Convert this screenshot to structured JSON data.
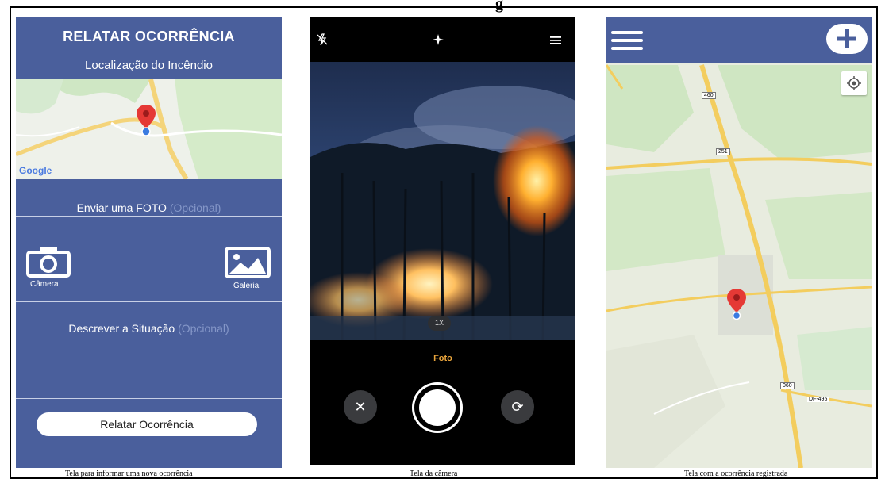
{
  "figure_title": "g",
  "report_screen": {
    "title": "RELATAR OCORRÊNCIA",
    "location_label": "Localização do Incêndio",
    "map_provider": "Google",
    "photo_label": "Enviar uma FOTO",
    "photo_optional": "(Opcional)",
    "camera_label": "Câmera",
    "camera_icon": "camera-icon",
    "gallery_label": "Galeria",
    "gallery_icon": "image-icon",
    "describe_label": "Descrever a Situação",
    "describe_optional": "(Opcional)",
    "submit_label": "Relatar Ocorrência",
    "bg_color": "#4a5f9c"
  },
  "camera_screen": {
    "flash_icon": "flash-off-icon",
    "sparkle_icon": "ai-enhance-icon",
    "menu_icon": "menu-icon",
    "zoom_label": "1X",
    "mode_label": "Foto",
    "close_icon": "close-icon",
    "switch_icon": "switch-camera-icon",
    "accent_color": "#e8a43c"
  },
  "map_screen": {
    "menu_icon": "hamburger-menu-icon",
    "add_icon": "plus-icon",
    "locate_icon": "my-location-icon",
    "road_labels": [
      "460",
      "251",
      "060",
      "DF-495"
    ]
  },
  "captions": {
    "report": "Tela para informar uma nova ocorrência",
    "camera": "Tela da câmera",
    "map": "Tela com a ocorrência registrada"
  }
}
